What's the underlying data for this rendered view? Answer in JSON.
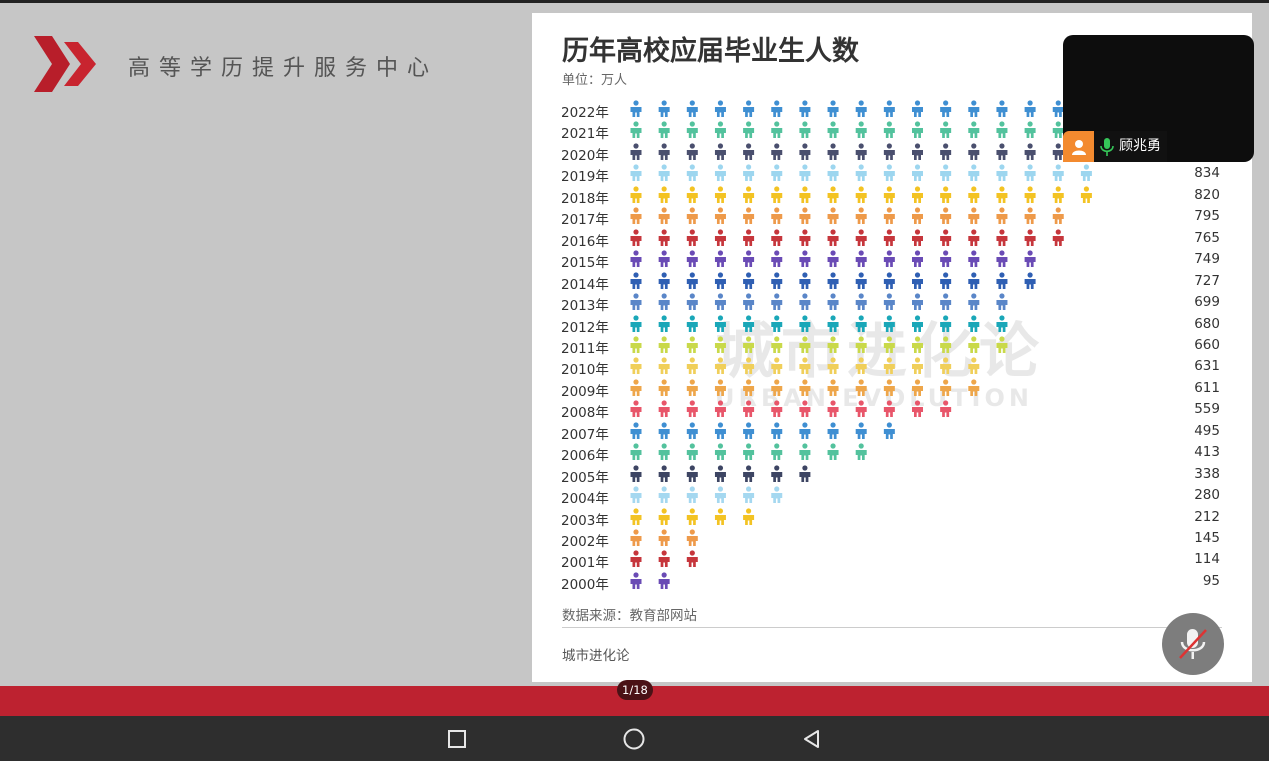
{
  "brand": {
    "name": "高等学历提升服务中心"
  },
  "slide": {
    "title": "历年高校应届毕业生人数",
    "unit": "单位：万人",
    "source": "数据来源：教育部网站",
    "footer": "城市进化论",
    "watermark_cn": "城市进化论",
    "watermark_en": "URBAN EVOLUTION"
  },
  "chart_data": {
    "type": "pictogram-bar",
    "title": "历年高校应届毕业生人数",
    "unit": "单位：万人",
    "rows": [
      {
        "year": "2022年",
        "value": null,
        "color": "#3f8fd2"
      },
      {
        "year": "2021年",
        "value": null,
        "color": "#53c29d"
      },
      {
        "year": "2020年",
        "value": null,
        "color": "#4a4f6e"
      },
      {
        "year": "2019年",
        "value": 834,
        "color": "#9dd6ef"
      },
      {
        "year": "2018年",
        "value": 820,
        "color": "#f3c323"
      },
      {
        "year": "2017年",
        "value": 795,
        "color": "#ee9a4a"
      },
      {
        "year": "2016年",
        "value": 765,
        "color": "#c6363c"
      },
      {
        "year": "2015年",
        "value": 749,
        "color": "#6a4bb5"
      },
      {
        "year": "2014年",
        "value": 727,
        "color": "#2f5fb3"
      },
      {
        "year": "2013年",
        "value": 699,
        "color": "#5a86c8"
      },
      {
        "year": "2012年",
        "value": 680,
        "color": "#1aa7b8"
      },
      {
        "year": "2011年",
        "value": 660,
        "color": "#c9d94a"
      },
      {
        "year": "2010年",
        "value": 631,
        "color": "#f0cf5a"
      },
      {
        "year": "2009年",
        "value": 611,
        "color": "#eea64a"
      },
      {
        "year": "2008年",
        "value": 559,
        "color": "#e8566a"
      },
      {
        "year": "2007年",
        "value": 495,
        "color": "#3f8fd2"
      },
      {
        "year": "2006年",
        "value": 413,
        "color": "#53c29d"
      },
      {
        "year": "2005年",
        "value": 338,
        "color": "#3d4563"
      },
      {
        "year": "2004年",
        "value": 280,
        "color": "#a5d8f0"
      },
      {
        "year": "2003年",
        "value": 212,
        "color": "#f3c323"
      },
      {
        "year": "2002年",
        "value": 145,
        "color": "#ee9a4a"
      },
      {
        "year": "2001年",
        "value": 114,
        "color": "#c6363c"
      },
      {
        "year": "2000年",
        "value": 95,
        "color": "#6a4bb5"
      }
    ]
  },
  "video": {
    "participant": "顾兆勇"
  },
  "presentation": {
    "page_indicator": "1/18"
  },
  "colors": {
    "accent_red": "#bd2230",
    "background": "#c6c6c6",
    "navbar": "#2e2e2e"
  },
  "icons": {
    "logo": "double-chevron-logo",
    "avatar": "person-icon",
    "mic": "microphone-icon",
    "mute": "mic-muted-icon",
    "nav_recent": "square-icon",
    "nav_home": "circle-icon",
    "nav_back": "triangle-back-icon"
  }
}
